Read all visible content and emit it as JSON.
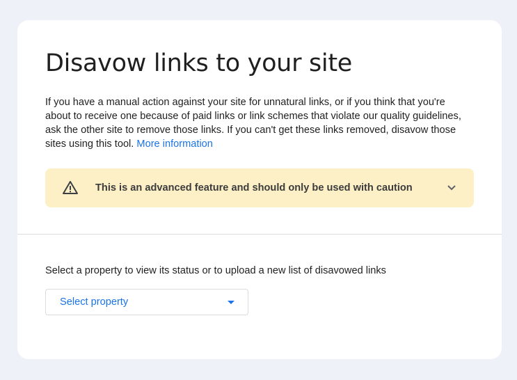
{
  "page": {
    "title": "Disavow links to your site",
    "intro_text": "If you have a manual action against your site for unnatural links, or if you think that you're about to receive one because of paid links or link schemes that violate our quality guidelines, ask the other site to remove those links. If you can't get these links removed, disavow those sites using this tool.",
    "more_info_link": "More information"
  },
  "warning": {
    "icon": "warning-triangle-icon",
    "text": "This is an advanced feature and should only be used with caution",
    "expand_icon": "chevron-down-icon"
  },
  "property": {
    "instruction": "Select a property to view its status or to upload a new list of disavowed links",
    "select_placeholder": "Select property",
    "caret_icon": "dropdown-caret-icon"
  },
  "colors": {
    "background": "#eef2f8",
    "card": "#ffffff",
    "link": "#1a73e8",
    "warning_bg": "#fdefc6"
  }
}
